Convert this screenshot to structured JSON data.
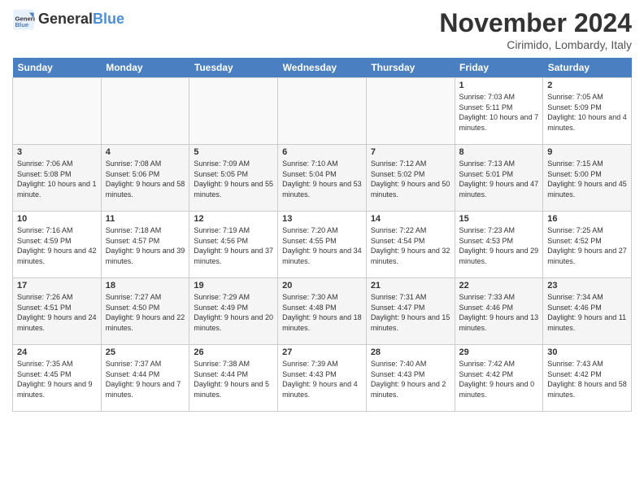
{
  "logo": {
    "text_general": "General",
    "text_blue": "Blue"
  },
  "header": {
    "month": "November 2024",
    "location": "Cirimido, Lombardy, Italy"
  },
  "days_of_week": [
    "Sunday",
    "Monday",
    "Tuesday",
    "Wednesday",
    "Thursday",
    "Friday",
    "Saturday"
  ],
  "weeks": [
    [
      {
        "day": "",
        "info": ""
      },
      {
        "day": "",
        "info": ""
      },
      {
        "day": "",
        "info": ""
      },
      {
        "day": "",
        "info": ""
      },
      {
        "day": "",
        "info": ""
      },
      {
        "day": "1",
        "info": "Sunrise: 7:03 AM\nSunset: 5:11 PM\nDaylight: 10 hours and 7 minutes."
      },
      {
        "day": "2",
        "info": "Sunrise: 7:05 AM\nSunset: 5:09 PM\nDaylight: 10 hours and 4 minutes."
      }
    ],
    [
      {
        "day": "3",
        "info": "Sunrise: 7:06 AM\nSunset: 5:08 PM\nDaylight: 10 hours and 1 minute."
      },
      {
        "day": "4",
        "info": "Sunrise: 7:08 AM\nSunset: 5:06 PM\nDaylight: 9 hours and 58 minutes."
      },
      {
        "day": "5",
        "info": "Sunrise: 7:09 AM\nSunset: 5:05 PM\nDaylight: 9 hours and 55 minutes."
      },
      {
        "day": "6",
        "info": "Sunrise: 7:10 AM\nSunset: 5:04 PM\nDaylight: 9 hours and 53 minutes."
      },
      {
        "day": "7",
        "info": "Sunrise: 7:12 AM\nSunset: 5:02 PM\nDaylight: 9 hours and 50 minutes."
      },
      {
        "day": "8",
        "info": "Sunrise: 7:13 AM\nSunset: 5:01 PM\nDaylight: 9 hours and 47 minutes."
      },
      {
        "day": "9",
        "info": "Sunrise: 7:15 AM\nSunset: 5:00 PM\nDaylight: 9 hours and 45 minutes."
      }
    ],
    [
      {
        "day": "10",
        "info": "Sunrise: 7:16 AM\nSunset: 4:59 PM\nDaylight: 9 hours and 42 minutes."
      },
      {
        "day": "11",
        "info": "Sunrise: 7:18 AM\nSunset: 4:57 PM\nDaylight: 9 hours and 39 minutes."
      },
      {
        "day": "12",
        "info": "Sunrise: 7:19 AM\nSunset: 4:56 PM\nDaylight: 9 hours and 37 minutes."
      },
      {
        "day": "13",
        "info": "Sunrise: 7:20 AM\nSunset: 4:55 PM\nDaylight: 9 hours and 34 minutes."
      },
      {
        "day": "14",
        "info": "Sunrise: 7:22 AM\nSunset: 4:54 PM\nDaylight: 9 hours and 32 minutes."
      },
      {
        "day": "15",
        "info": "Sunrise: 7:23 AM\nSunset: 4:53 PM\nDaylight: 9 hours and 29 minutes."
      },
      {
        "day": "16",
        "info": "Sunrise: 7:25 AM\nSunset: 4:52 PM\nDaylight: 9 hours and 27 minutes."
      }
    ],
    [
      {
        "day": "17",
        "info": "Sunrise: 7:26 AM\nSunset: 4:51 PM\nDaylight: 9 hours and 24 minutes."
      },
      {
        "day": "18",
        "info": "Sunrise: 7:27 AM\nSunset: 4:50 PM\nDaylight: 9 hours and 22 minutes."
      },
      {
        "day": "19",
        "info": "Sunrise: 7:29 AM\nSunset: 4:49 PM\nDaylight: 9 hours and 20 minutes."
      },
      {
        "day": "20",
        "info": "Sunrise: 7:30 AM\nSunset: 4:48 PM\nDaylight: 9 hours and 18 minutes."
      },
      {
        "day": "21",
        "info": "Sunrise: 7:31 AM\nSunset: 4:47 PM\nDaylight: 9 hours and 15 minutes."
      },
      {
        "day": "22",
        "info": "Sunrise: 7:33 AM\nSunset: 4:46 PM\nDaylight: 9 hours and 13 minutes."
      },
      {
        "day": "23",
        "info": "Sunrise: 7:34 AM\nSunset: 4:46 PM\nDaylight: 9 hours and 11 minutes."
      }
    ],
    [
      {
        "day": "24",
        "info": "Sunrise: 7:35 AM\nSunset: 4:45 PM\nDaylight: 9 hours and 9 minutes."
      },
      {
        "day": "25",
        "info": "Sunrise: 7:37 AM\nSunset: 4:44 PM\nDaylight: 9 hours and 7 minutes."
      },
      {
        "day": "26",
        "info": "Sunrise: 7:38 AM\nSunset: 4:44 PM\nDaylight: 9 hours and 5 minutes."
      },
      {
        "day": "27",
        "info": "Sunrise: 7:39 AM\nSunset: 4:43 PM\nDaylight: 9 hours and 4 minutes."
      },
      {
        "day": "28",
        "info": "Sunrise: 7:40 AM\nSunset: 4:43 PM\nDaylight: 9 hours and 2 minutes."
      },
      {
        "day": "29",
        "info": "Sunrise: 7:42 AM\nSunset: 4:42 PM\nDaylight: 9 hours and 0 minutes."
      },
      {
        "day": "30",
        "info": "Sunrise: 7:43 AM\nSunset: 4:42 PM\nDaylight: 8 hours and 58 minutes."
      }
    ]
  ]
}
